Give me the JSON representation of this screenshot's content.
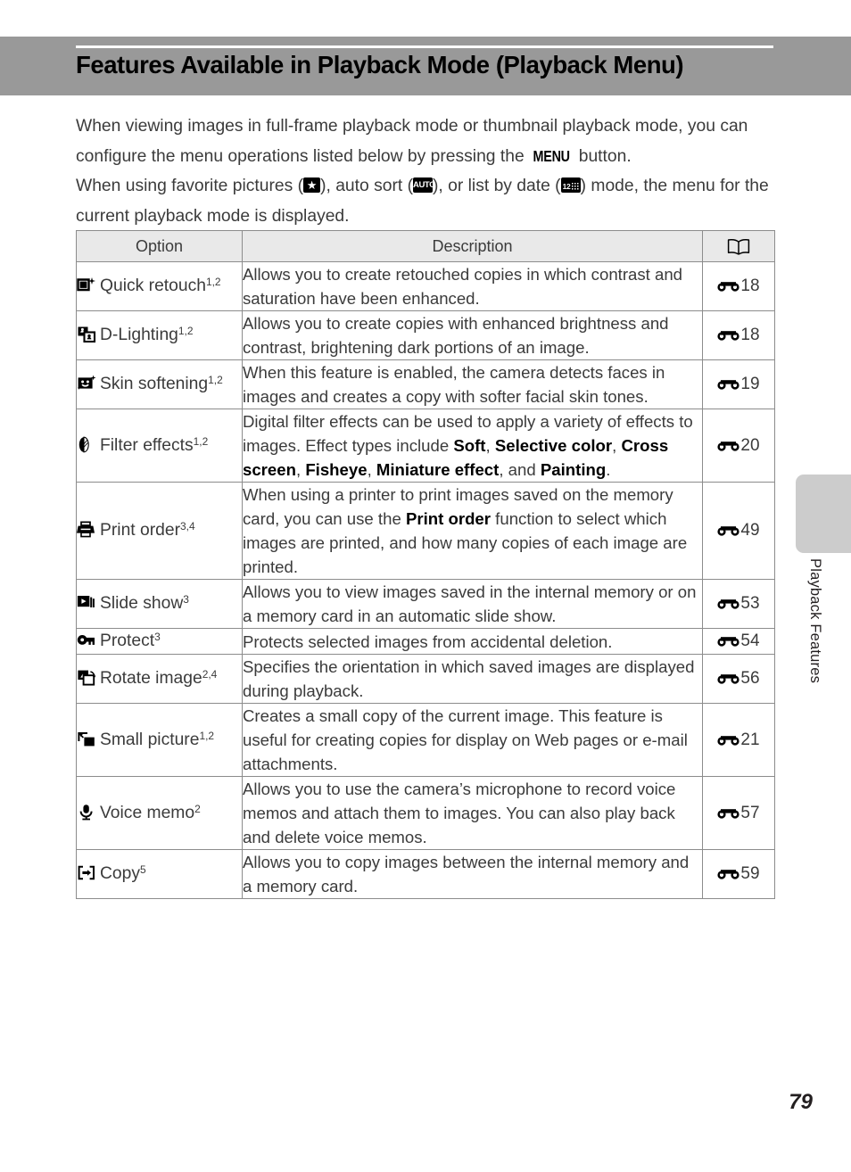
{
  "header": {
    "title": "Features Available in Playback Mode (Playback Menu)"
  },
  "intro": {
    "line1_a": "When viewing images in full-frame playback mode or thumbnail playback mode, you can configure the menu operations listed below by pressing the ",
    "menu_glyph": "MENU",
    "line1_b": " button.",
    "line2_a": "When using favorite pictures (",
    "fav_icon": "★",
    "line2_b": "), auto sort (",
    "auto_icon": "AUTO",
    "line2_c": "), or list by date (",
    "date_icon_num": "12",
    "line2_d": ") mode, the menu for the current playback mode is displayed."
  },
  "table": {
    "headers": {
      "option": "Option",
      "description": "Description",
      "reference": "book-icon"
    },
    "rows": [
      {
        "icon": "quick-retouch-icon",
        "option": "Quick retouch",
        "option_sup": "1,2",
        "description": "Allows you to create retouched copies in which contrast and saturation have been enhanced.",
        "ref": "18"
      },
      {
        "icon": "d-lighting-icon",
        "option": "D-Lighting",
        "option_sup": "1,2",
        "description": "Allows you to create copies with enhanced brightness and contrast, brightening dark portions of an image.",
        "ref": "18"
      },
      {
        "icon": "skin-softening-icon",
        "option": "Skin softening",
        "option_sup": "1,2",
        "description": "When this feature is enabled, the camera detects faces in images and creates a copy with softer facial skin tones.",
        "ref": "19"
      },
      {
        "icon": "filter-effects-icon",
        "option": "Filter effects",
        "option_sup": "1,2",
        "description_parts": [
          {
            "text": "Digital filter effects can be used to apply a variety of effects to images. Effect types include ",
            "bold": false
          },
          {
            "text": "Soft",
            "bold": true
          },
          {
            "text": ", ",
            "bold": false
          },
          {
            "text": "Selective color",
            "bold": true
          },
          {
            "text": ", ",
            "bold": false
          },
          {
            "text": "Cross screen",
            "bold": true
          },
          {
            "text": ", ",
            "bold": false
          },
          {
            "text": "Fisheye",
            "bold": true
          },
          {
            "text": ", ",
            "bold": false
          },
          {
            "text": "Miniature effect",
            "bold": true
          },
          {
            "text": ", and ",
            "bold": false
          },
          {
            "text": "Painting",
            "bold": true
          },
          {
            "text": ".",
            "bold": false
          }
        ],
        "ref": "20"
      },
      {
        "icon": "print-order-icon",
        "option": "Print order",
        "option_sup": "3,4",
        "description_parts": [
          {
            "text": "When using a printer to print images saved on the memory card, you can use the ",
            "bold": false
          },
          {
            "text": "Print order",
            "bold": true
          },
          {
            "text": " function to select which images are printed, and how many copies of each image are printed.",
            "bold": false
          }
        ],
        "ref": "49"
      },
      {
        "icon": "slide-show-icon",
        "option": "Slide show",
        "option_sup": "3",
        "description": "Allows you to view images saved in the internal memory or on a memory card in an automatic slide show.",
        "ref": "53"
      },
      {
        "icon": "protect-icon",
        "option": "Protect",
        "option_sup": "3",
        "description": "Protects selected images from accidental deletion.",
        "ref": "54"
      },
      {
        "icon": "rotate-image-icon",
        "option": "Rotate image",
        "option_sup": "2,4",
        "description": "Specifies the orientation in which saved images are displayed during playback.",
        "ref": "56"
      },
      {
        "icon": "small-picture-icon",
        "option": "Small picture",
        "option_sup": "1,2",
        "description": "Creates a small copy of the current image. This feature is useful for creating copies for display on Web pages or e-mail attachments.",
        "ref": "21"
      },
      {
        "icon": "voice-memo-icon",
        "option": "Voice memo",
        "option_sup": "2",
        "description": "Allows you to use the camera’s microphone to record voice memos and attach them to images. You can also play back and delete voice memos.",
        "ref": "57"
      },
      {
        "icon": "copy-icon",
        "option": "Copy",
        "option_sup": "5",
        "description": "Allows you to copy images between the internal memory and a memory card.",
        "ref": "59"
      }
    ]
  },
  "side_tab": {
    "label": "Playback Features"
  },
  "footer": {
    "page_number": "79"
  },
  "colors": {
    "header_band": "#999999",
    "table_header_bg": "#e9e9e9",
    "border": "#8c8c8c",
    "side_tab": "#cccccc",
    "text": "#3b3b3b"
  }
}
